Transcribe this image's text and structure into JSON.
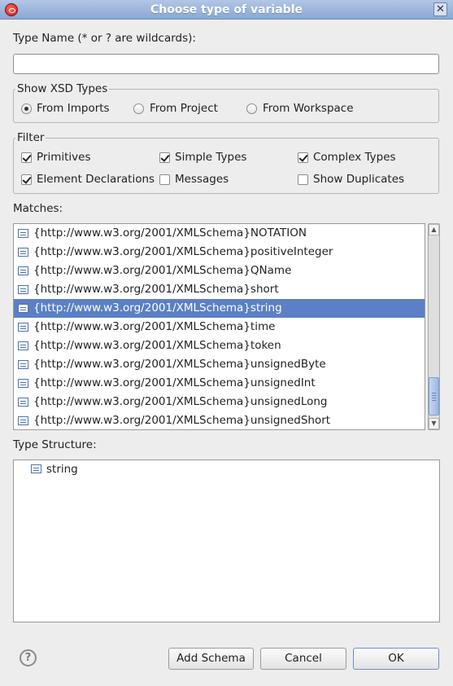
{
  "window": {
    "title": "Choose type of variable"
  },
  "type_name": {
    "label": "Type Name (* or ? are wildcards):",
    "value": ""
  },
  "xsd_group": {
    "label": "Show XSD Types",
    "options": [
      {
        "label": "From Imports",
        "checked": true
      },
      {
        "label": "From Project",
        "checked": false
      },
      {
        "label": "From Workspace",
        "checked": false
      }
    ]
  },
  "filter_group": {
    "label": "Filter",
    "options": [
      {
        "label": "Primitives",
        "checked": true
      },
      {
        "label": "Simple Types",
        "checked": true
      },
      {
        "label": "Complex Types",
        "checked": true
      },
      {
        "label": "Element Declarations",
        "checked": true
      },
      {
        "label": "Messages",
        "checked": false
      },
      {
        "label": "Show Duplicates",
        "checked": false
      }
    ]
  },
  "matches": {
    "label": "Matches:",
    "selected_index": 4,
    "items": [
      "{http://www.w3.org/2001/XMLSchema}NOTATION",
      "{http://www.w3.org/2001/XMLSchema}positiveInteger",
      "{http://www.w3.org/2001/XMLSchema}QName",
      "{http://www.w3.org/2001/XMLSchema}short",
      "{http://www.w3.org/2001/XMLSchema}string",
      "{http://www.w3.org/2001/XMLSchema}time",
      "{http://www.w3.org/2001/XMLSchema}token",
      "{http://www.w3.org/2001/XMLSchema}unsignedByte",
      "{http://www.w3.org/2001/XMLSchema}unsignedInt",
      "{http://www.w3.org/2001/XMLSchema}unsignedLong",
      "{http://www.w3.org/2001/XMLSchema}unsignedShort"
    ]
  },
  "structure": {
    "label": "Type Structure:",
    "node": "string"
  },
  "buttons": {
    "add_schema": "Add Schema",
    "cancel": "Cancel",
    "ok": "OK"
  },
  "icons": {
    "app": "app-icon",
    "close": "close-icon",
    "type": "type-icon",
    "help": "help-icon",
    "help_glyph": "?",
    "close_glyph": "✕",
    "scroll_up_glyph": "▲",
    "scroll_down_glyph": "▼"
  },
  "colors": {
    "selection": "#5b80c5",
    "title_bar": "#8aa7d3"
  }
}
